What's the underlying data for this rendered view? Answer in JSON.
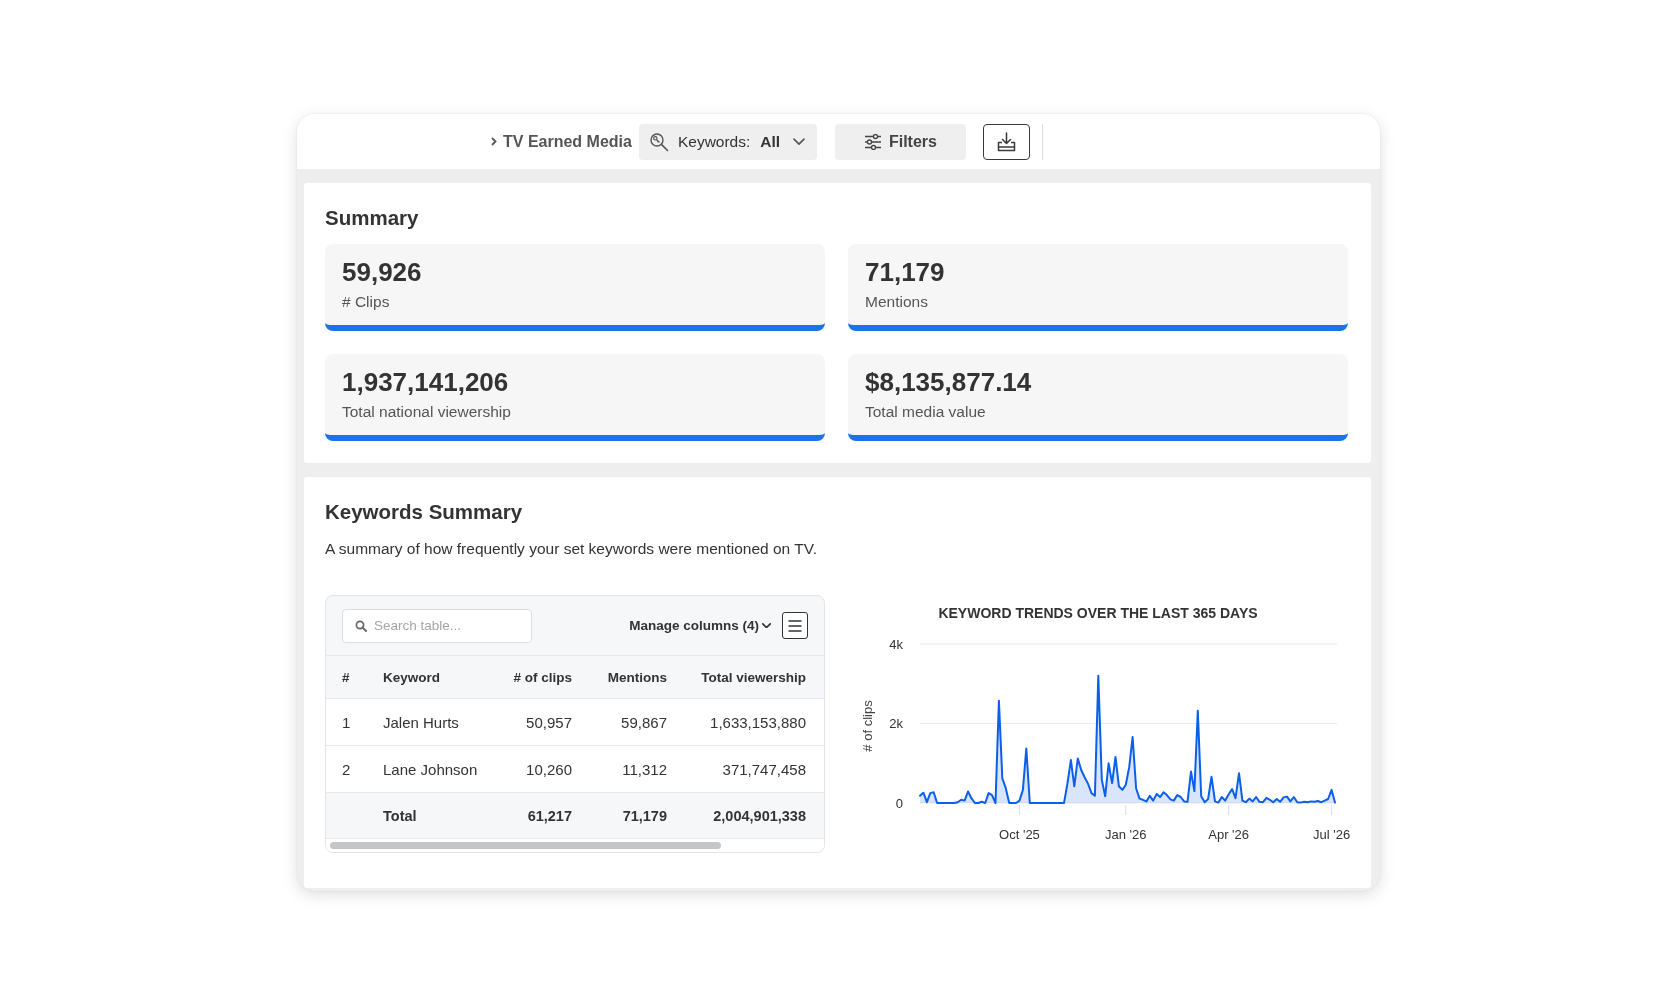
{
  "toolbar": {
    "breadcrumb": "TV Earned Media",
    "keyword_filter": {
      "label": "Keywords:",
      "value": "All"
    },
    "filters_button": "Filters"
  },
  "summary": {
    "title": "Summary",
    "cards": [
      {
        "value": "59,926",
        "label": "# Clips"
      },
      {
        "value": "71,179",
        "label": "Mentions"
      },
      {
        "value": "1,937,141,206",
        "label": "Total national viewership"
      },
      {
        "value": "$8,135,877.14",
        "label": "Total media value"
      }
    ]
  },
  "keywords_summary": {
    "title": "Keywords Summary",
    "description": "A summary of how frequently your set keywords were mentioned on TV.",
    "table": {
      "search": {
        "placeholder": "Search table..."
      },
      "manage_columns": "Manage columns (4)",
      "columns": [
        "#",
        "Keyword",
        "# of clips",
        "Mentions",
        "Total viewership"
      ],
      "rows": [
        [
          "1",
          "Jalen Hurts",
          "50,957",
          "59,867",
          "1,633,153,880"
        ],
        [
          "2",
          "Lane Johnson",
          "10,260",
          "11,312",
          "371,747,458"
        ]
      ],
      "total": {
        "label": "Total",
        "cells": [
          "61,217",
          "71,179",
          "2,004,901,338"
        ]
      }
    },
    "chart": {
      "chart_data": {
        "type": "area",
        "title": "KEYWORD TRENDS OVER THE LAST 365 DAYS",
        "ylabel": "# of clips",
        "categories": [
          null,
          null,
          null,
          null,
          null,
          null,
          null,
          null,
          null,
          null,
          null,
          null,
          null,
          null,
          null,
          null,
          null,
          null,
          null,
          null,
          null,
          null,
          null,
          null,
          null,
          null,
          null,
          null,
          null,
          "Oct '25",
          null,
          null,
          null,
          null,
          null,
          null,
          null,
          null,
          null,
          null,
          null,
          null,
          null,
          null,
          null,
          null,
          null,
          null,
          null,
          null,
          null,
          null,
          null,
          null,
          null,
          null,
          null,
          null,
          null,
          null,
          "Jan '26",
          null,
          null,
          null,
          null,
          null,
          null,
          null,
          null,
          null,
          null,
          null,
          null,
          null,
          null,
          null,
          null,
          null,
          null,
          null,
          null,
          null,
          null,
          null,
          null,
          null,
          null,
          null,
          null,
          null,
          "Apr '26",
          null,
          null,
          null,
          null,
          null,
          null,
          null,
          null,
          null,
          null,
          null,
          null,
          null,
          null,
          null,
          null,
          null,
          null,
          null,
          null,
          null,
          null,
          null,
          null,
          null,
          null,
          null,
          null,
          null,
          "Jul '26",
          null
        ],
        "series": [
          {
            "color": "#0b5fea",
            "values": [
              180,
              260,
              20,
              250,
              270,
              0,
              0,
              0,
              0,
              0,
              0,
              20,
              80,
              60,
              290,
              120,
              0,
              0,
              30,
              0,
              250,
              200,
              0,
              2570,
              620,
              380,
              0,
              0,
              0,
              60,
              330,
              1370,
              0,
              0,
              0,
              0,
              0,
              0,
              0,
              0,
              0,
              0,
              0,
              500,
              1080,
              420,
              1120,
              830,
              650,
              480,
              250,
              180,
              3200,
              580,
              170,
              1000,
              500,
              1160,
              420,
              330,
              460,
              900,
              1660,
              370,
              110,
              80,
              40,
              180,
              60,
              230,
              150,
              270,
              200,
              90,
              60,
              200,
              150,
              40,
              30,
              790,
              300,
              2320,
              170,
              20,
              100,
              660,
              40,
              10,
              150,
              60,
              220,
              350,
              120,
              750,
              60,
              20,
              110,
              40,
              150,
              30,
              20,
              130,
              80,
              20,
              100,
              30,
              140,
              160,
              40,
              150,
              20,
              10,
              30,
              20,
              40,
              30,
              50,
              20,
              60,
              100,
              330,
              10
            ]
          }
        ],
        "ylim": [
          0,
          4000
        ],
        "yticks": [
          {
            "value": 0,
            "label": "0"
          },
          {
            "value": 2000,
            "label": "2k"
          },
          {
            "value": 4000,
            "label": "4k"
          }
        ]
      }
    }
  }
}
